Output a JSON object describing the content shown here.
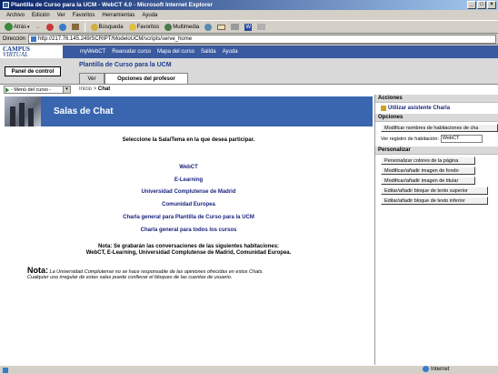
{
  "window": {
    "title": "Plantilla de Curso para la UCM - WebCT 4.0 - Microsoft Internet Explorer"
  },
  "menubar": [
    "Archivo",
    "Edición",
    "Ver",
    "Favoritos",
    "Herramientas",
    "Ayuda"
  ],
  "toolbar": {
    "back": "Atrás",
    "search": "Búsqueda",
    "favorites": "Favoritos",
    "multimedia": "Multimedia"
  },
  "address": {
    "label": "Dirección",
    "url": "http://217.76.145.249/SCRIPT/ModeloUCM/scripts/serve_home"
  },
  "webct": {
    "logo_line1": "CAMPUS",
    "logo_line2": "VIRTUAL",
    "topnav": [
      "myWebCT",
      "Reanudar curso",
      "Mapa del curso",
      "Salida",
      "Ayuda"
    ],
    "panel_button": "Panel de control",
    "course_title": "Plantilla de Curso para la UCM",
    "tab_view": "Ver",
    "tab_teacher": "Opciones del profesor",
    "menu_select": "- Menú del curso -",
    "breadcrumb_home": "Inicio",
    "breadcrumb_sep": ">",
    "breadcrumb_current": "Chat"
  },
  "main": {
    "banner_title": "Salas de Chat",
    "instruction": "Seleccione la Sala/Tema en la que desea participar.",
    "rooms": [
      "WebCT",
      "E-Learning",
      "Universidad Complutense de Madrid",
      "Comunidad Europea",
      "Charla general para Plantilla de Curso para la UCM",
      "Charla general para todos los cursos"
    ],
    "recording_note_1": "Nota: Se grabarán las conversaciones de las siguientes habitaciones:",
    "recording_note_2": "WebCT, E-Learning, Universidad Complutense de Madrid, Comunidad Europea.",
    "disclaimer_label": "Nota:",
    "disclaimer_1": " La Universidad Complutense no se hace responsable de las opiniones ofrecidas en estos Chats.",
    "disclaimer_2": "Cualquier uso irregular de estas salas puede conllevar el bloqueo de las cuentas de usuario."
  },
  "side": {
    "actions_header": "Acciones",
    "assistant_link": "Utilizar asistente Charla",
    "options_header": "Opciones",
    "modify_names_button": "Modificar nombres de habitaciones de cha",
    "record_label": "Ver registro de habitación:",
    "record_value": "WebCT",
    "personalize_header": "Personalizar",
    "buttons": [
      "Personalizar colores de la página",
      "Modificar/añadir imagen de fondo",
      "Modificar/añadir imagen de titular",
      "Editar/añadir bloque de texto superior",
      "Editar/añadir bloque de texto inferior"
    ]
  },
  "status": {
    "zone": "Internet"
  }
}
